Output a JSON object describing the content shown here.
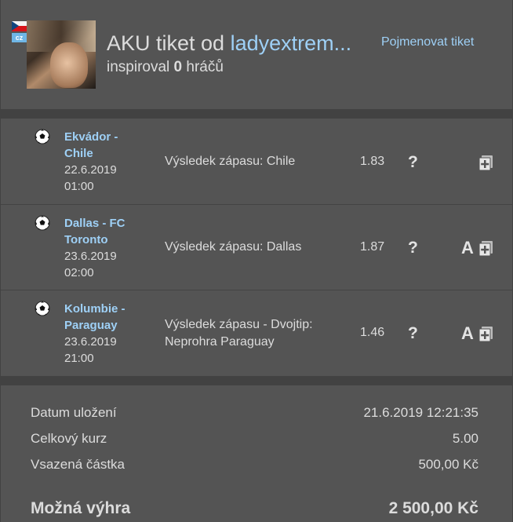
{
  "header": {
    "lang_badge": "cz",
    "title_prefix": "AKU tiket od ",
    "username": "ladyextrem...",
    "subtitle_prefix": "inspiroval ",
    "inspired_count": "0",
    "subtitle_suffix": " hráčů",
    "rename_label": "Pojmenovat tiket"
  },
  "matches": [
    {
      "teams": [
        "Ekvádor -",
        "Chile"
      ],
      "date": "22.6.2019",
      "time": "01:00",
      "bet": [
        "Výsledek zápasu: Chile"
      ],
      "odds": "1.83",
      "help": "?",
      "a_badge": ""
    },
    {
      "teams": [
        "Dallas - FC",
        "Toronto"
      ],
      "date": "23.6.2019",
      "time": "02:00",
      "bet": [
        "Výsledek zápasu: Dallas"
      ],
      "odds": "1.87",
      "help": "?",
      "a_badge": "A"
    },
    {
      "teams": [
        "Kolumbie -",
        "Paraguay"
      ],
      "date": "23.6.2019",
      "time": "21:00",
      "bet": [
        "Výsledek zápasu - Dvojtip:",
        "Neprohra Paraguay"
      ],
      "odds": "1.46",
      "help": "?",
      "a_badge": "A"
    }
  ],
  "summary": {
    "saved_label": "Datum uložení",
    "saved_value": "21.6.2019 12:21:35",
    "odds_label": "Celkový kurz",
    "odds_value": "5.00",
    "stake_label": "Vsazená částka",
    "stake_value": "500,00 Kč",
    "win_label": "Možná výhra",
    "win_value": "2 500,00 Kč"
  },
  "icons": {
    "sport": "soccer-ball-icon",
    "help": "question-mark-icon",
    "add": "add-to-ticket-icon"
  }
}
